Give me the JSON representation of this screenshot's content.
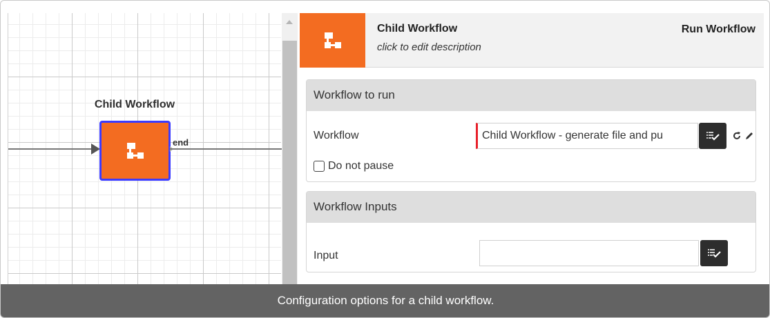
{
  "canvas": {
    "node_title": "Child Workflow",
    "end_label": "end",
    "node_icon": "workflow-hierarchy-icon"
  },
  "panel": {
    "header": {
      "title": "Child Workflow",
      "description": "click to edit description",
      "action": "Run Workflow",
      "icon": "workflow-hierarchy-icon"
    },
    "section1": {
      "title": "Workflow to run",
      "workflow_label": "Workflow",
      "workflow_value": "Child Workflow - generate file and pu",
      "checkbox_label": "Do not pause"
    },
    "section2": {
      "title": "Workflow Inputs",
      "input_label": "Input",
      "input_value": ""
    }
  },
  "caption": "Configuration options for a child workflow.",
  "colors": {
    "accent": "#f36c21",
    "selection": "#3b3bff",
    "required": "#e8202a",
    "button": "#2d2d2d",
    "caption_bg": "#636363"
  }
}
